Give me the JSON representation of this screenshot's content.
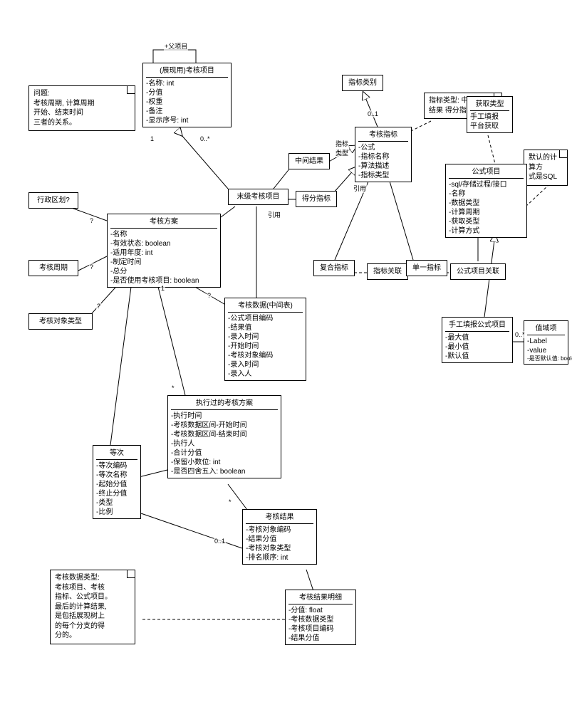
{
  "notes": {
    "problem": {
      "l1": "问题:",
      "l2": "考核周期, 计算周期",
      "l3": "开始、结束时间",
      "l4": "三者的关系。"
    },
    "dataTypes": {
      "l1": "考核数据类型:",
      "l2": "考核项目、考核",
      "l3": "指标、公式项目。",
      "l4": "最后的计算结果,",
      "l5": "是包括展现树上",
      "l6": "的每个分支的得",
      "l7": "分的。"
    },
    "indicatorTypes": {
      "l1": "指标类型: 中间",
      "l2": "结果  得分指标"
    },
    "calcMethod": {
      "l1": "默认的计算方",
      "l2": "式是SQL"
    }
  },
  "classes": {
    "adminDivision": {
      "title": "行政区划?"
    },
    "assessCycle": {
      "title": "考核周期"
    },
    "targetType": {
      "title": "考核对象类型"
    },
    "scheme": {
      "title": "考核方案",
      "a1": "-名称",
      "a2": "-有效状态: boolean",
      "a3": "-适用年度: int",
      "a4": "-制定时间",
      "a5": "-总分",
      "a6": "-是否使用考核项目: boolean"
    },
    "reuseItem": {
      "title": "(展现用)考核项目",
      "a1": "-名称: int",
      "a2": "-分值",
      "a3": "-权重",
      "a4": "-备注",
      "a5": "-显示序号: int"
    },
    "leafItem": {
      "title": "末级考核项目"
    },
    "midResult": {
      "title": "中间结果"
    },
    "scoreIndicator": {
      "title": "得分指标"
    },
    "indicatorCategory": {
      "title": "指标类别"
    },
    "assessIndicator": {
      "title": "考核指标",
      "a1": "-公式",
      "a2": "-指标名称",
      "a3": "-算法描述",
      "a4": "-指标类型"
    },
    "acquireType": {
      "title": "获取类型",
      "a1": "手工填报",
      "a2": "平台获取"
    },
    "formulaItem": {
      "title": "公式项目",
      "a1": "-sql/存储过程/接口",
      "a2": "-名称",
      "a3": "-数据类型",
      "a4": "-计算周期",
      "a5": "-获取类型",
      "a6": "-计算方式"
    },
    "compositeIndicator": {
      "title": "复合指标"
    },
    "indicatorAssoc": {
      "title": "指标关联"
    },
    "singleIndicator": {
      "title": "单一指标"
    },
    "formulaItemAssoc": {
      "title": "公式项目关联"
    },
    "manualFormulaItem": {
      "title": "手工填报公式项目",
      "a1": "-最大值",
      "a2": "-最小值",
      "a3": "-默认值"
    },
    "valueDomain": {
      "title": "值域项",
      "a1": "-Label",
      "a2": "-value",
      "a3": "-是否默认值: boolean"
    },
    "assessData": {
      "title": "考核数据(中间表)",
      "a1": "-公式项目编码",
      "a2": "-结果值",
      "a3": "-录入时间",
      "a4": "-开始时间",
      "a5": "-考核对象编码",
      "a6": "-录入时间",
      "a7": "-录入人"
    },
    "executedScheme": {
      "title": "执行过的考核方案",
      "a1": "-执行时间",
      "a2": "-考核数据区间-开始时间",
      "a3": "-考核数据区间-结束时间",
      "a4": "-执行人",
      "a5": "-合计分值",
      "a6": "-保留小数位: int",
      "a7": "-是否四舍五入: boolean"
    },
    "grade": {
      "title": "等次",
      "a1": "-等次编码",
      "a2": "-等次名称",
      "a3": "-起始分值",
      "a4": "-终止分值",
      "a5": "-类型",
      "a6": "-比例"
    },
    "assessResult": {
      "title": "考核结果",
      "a1": "-考核对象编码",
      "a2": "-结果分值",
      "a3": "-考核对象类型",
      "a4": "-排名顺序: int"
    },
    "resultDetail": {
      "title": "考核结果明细",
      "a1": "-分值: float",
      "a2": "-考核数据类型",
      "a3": "-考核项目编码",
      "a4": "-结果分值"
    }
  },
  "labels": {
    "parentItem": "+父项目",
    "ref1": "引用",
    "ref2": "引用",
    "indicatorType": "指标\n类型",
    "m0star": "0..*",
    "m0star2": "0..*",
    "m01": "0..1",
    "m01b": "0..1",
    "one": "1",
    "one2": "1",
    "star": "*",
    "star2": "*",
    "q": "?",
    "q2": "?",
    "q3": "?",
    "q4": "?"
  }
}
